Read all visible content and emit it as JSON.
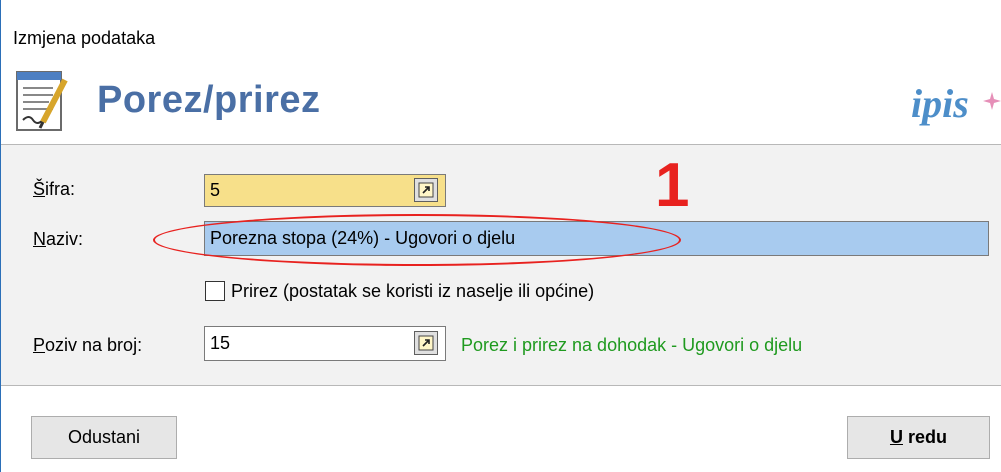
{
  "window": {
    "title": "Izmjena podataka"
  },
  "header": {
    "heading": "Porez/prirez",
    "logo_text": "ipis",
    "icon": "document-edit-icon"
  },
  "fields": {
    "sifra": {
      "label": "Šifra:",
      "value": "5"
    },
    "naziv": {
      "label": "Naziv:",
      "value": "Porezna stopa (24%) - Ugovori o djelu"
    },
    "prirez": {
      "label": "Prirez (postatak se koristi iz naselje ili općine)",
      "checked": false
    },
    "poziv": {
      "label": "Poziv na broj:",
      "value": "15",
      "description": "Porez i prirez na dohodak - Ugovori o djelu"
    }
  },
  "annotation": {
    "number": "1"
  },
  "buttons": {
    "cancel": "Odustani",
    "ok": "U redu"
  },
  "colors": {
    "sifra_bg": "#f7e08a",
    "naziv_bg": "#a8cbef",
    "annotation": "#e8221f",
    "description": "#1f9a1f",
    "heading": "#4a6fa5"
  }
}
